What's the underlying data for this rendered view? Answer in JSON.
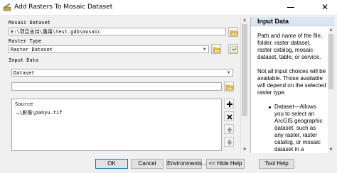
{
  "window": {
    "title": "Add Rasters To Mosaic Dataset",
    "close_glyph": "✕"
  },
  "form": {
    "mosaic_label": "Mosaic Dataset",
    "mosaic_value": "E:\\项目支持\\番禺\\test.gdb\\mosaic",
    "raster_type_label": "Raster Type",
    "raster_type_value": "Raster Dataset",
    "input_data_label": "Input Data",
    "input_type_value": "Dataset",
    "input_path_value": "",
    "source_header": "Source",
    "source_items": [
      "…\\影像\\panyu.tif"
    ]
  },
  "help": {
    "title": "Input Data",
    "paragraph1": [
      "Path and name of the file,",
      "folder, raster dataset,",
      "raster catalog, mosaic",
      "dataset, table, or service."
    ],
    "paragraph2": [
      "Not all input choices will be",
      "available. Those available",
      "will depend on the selected",
      "raster type."
    ],
    "bullet1": [
      "Dataset—Allows",
      "you to select an",
      "ArcGIS geographic",
      "dataset, such as",
      "any raster, raster",
      "catalog, or mosaic",
      "dataset in a"
    ]
  },
  "buttons": {
    "ok": "OK",
    "cancel": "Cancel",
    "environments": "Environments...",
    "hide_help": "<< Hide Help",
    "tool_help": "Tool Help"
  },
  "icons": {
    "app": "toolbox-icon",
    "browse": "folder-open-icon",
    "properties": "properties-icon",
    "add": "plus-icon",
    "remove": "x-icon",
    "up": "arrow-up-icon",
    "down": "arrow-down-icon"
  }
}
